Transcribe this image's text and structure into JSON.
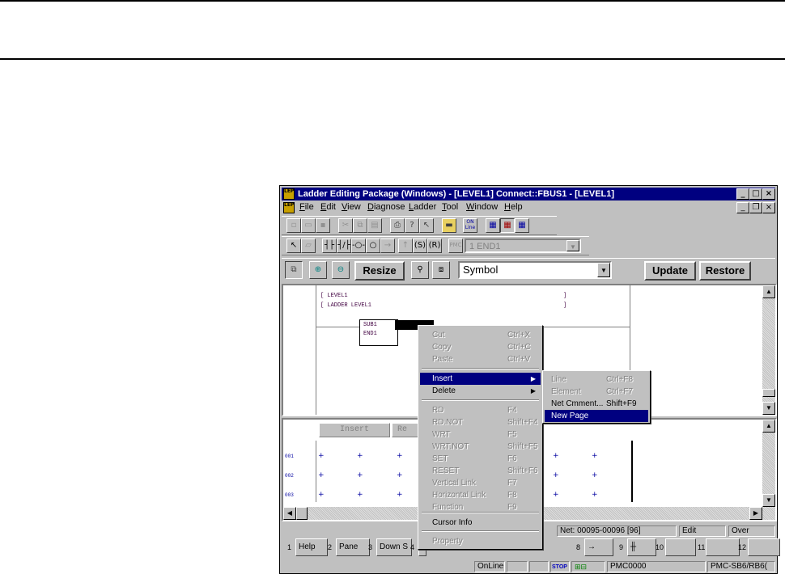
{
  "window": {
    "title": "Ladder Editing Package (Windows) - [LEVEL1]     Connect::FBUS1 - [LEVEL1]",
    "icon_text": "LEP"
  },
  "menu": [
    "File",
    "Edit",
    "View",
    "Diagnose",
    "Ladder",
    "Tool",
    "Window",
    "Help"
  ],
  "toolbar2": {
    "pmc_label": "PMC",
    "program_select": "1 END1"
  },
  "toolbar3": {
    "resize_label": "Resize",
    "symbol_select": "Symbol",
    "update_label": "Update",
    "restore_label": "Restore"
  },
  "toolbar1": {
    "online_label": "ON Line"
  },
  "ladder": {
    "line1_left": "[ LEVEL1",
    "line1_right": "]",
    "line2_left": "[ LADDER LEVEL1",
    "line2_right": "]",
    "block_line1": "SUB1",
    "block_line2": "END1"
  },
  "lower_pane": {
    "insert_label": "Insert",
    "re_label": "Re",
    "rows": [
      "001",
      "002",
      "003"
    ]
  },
  "context_menu": [
    {
      "label": "Cut",
      "shortcut": "Ctrl+X",
      "enabled": false
    },
    {
      "label": "Copy",
      "shortcut": "Ctrl+C",
      "enabled": false
    },
    {
      "label": "Paste",
      "shortcut": "Ctrl+V",
      "enabled": false
    },
    {
      "label": "Insert",
      "shortcut": "",
      "enabled": true,
      "submenu": true,
      "selected": true
    },
    {
      "label": "Delete",
      "shortcut": "",
      "enabled": true,
      "submenu": true
    },
    {
      "label": "RD",
      "shortcut": "F4",
      "enabled": false
    },
    {
      "label": "RD.NOT",
      "shortcut": "Shift+F4",
      "enabled": false
    },
    {
      "label": "WRT",
      "shortcut": "F5",
      "enabled": false
    },
    {
      "label": "WRT.NOT",
      "shortcut": "Shift+F5",
      "enabled": false
    },
    {
      "label": "SET",
      "shortcut": "F6",
      "enabled": false
    },
    {
      "label": "RESET",
      "shortcut": "Shift+F6",
      "enabled": false
    },
    {
      "label": "Vertical Link",
      "shortcut": "F7",
      "enabled": false
    },
    {
      "label": "Horizontal Link",
      "shortcut": "F8",
      "enabled": false
    },
    {
      "label": "Function",
      "shortcut": "F9",
      "enabled": false
    },
    {
      "label": "Cursor Info",
      "shortcut": "",
      "enabled": true
    },
    {
      "label": "Property",
      "shortcut": "",
      "enabled": false
    }
  ],
  "submenu": [
    {
      "label": "Line",
      "shortcut": "Ctrl+F8",
      "enabled": false
    },
    {
      "label": "Element",
      "shortcut": "Ctrl+F7",
      "enabled": false
    },
    {
      "label": "Net Cmment...",
      "shortcut": "Shift+F9",
      "enabled": true
    },
    {
      "label": "New Page",
      "shortcut": "",
      "enabled": true,
      "selected": true
    }
  ],
  "status_top": {
    "net": "Net: 00095-00096 [96]",
    "edit": "Edit",
    "over": "Over"
  },
  "fkeys": [
    {
      "num": "1",
      "label": "Help"
    },
    {
      "num": "2",
      "label": "Pane"
    },
    {
      "num": "3",
      "label": "Down S"
    },
    {
      "num": "4",
      "label": ""
    },
    {
      "num": "8",
      "label": "→"
    },
    {
      "num": "9",
      "label": "╫"
    },
    {
      "num": "10",
      "label": ""
    },
    {
      "num": "11",
      "label": ""
    },
    {
      "num": "12",
      "label": ""
    }
  ],
  "status_bottom": {
    "online": "OnLine",
    "stop": "STOP",
    "pmc": "PMC0000",
    "model": "PMC-SB6/RB6("
  }
}
